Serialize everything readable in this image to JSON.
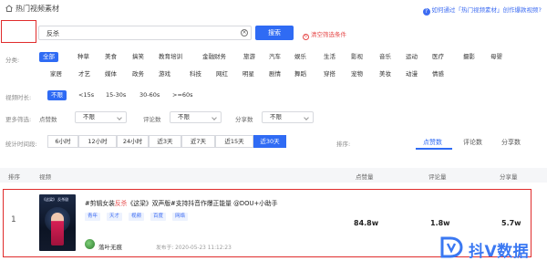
{
  "header": {
    "title": "热门视频素材",
    "help_text": "如何通过「热门视频素材」创作爆款视频?"
  },
  "search": {
    "value": "反杀",
    "button_label": "搜索",
    "clear_filters_label": "清空筛选条件"
  },
  "filters": {
    "category": {
      "label": "分类:",
      "row1": [
        "全部",
        "种草",
        "美食",
        "搞笑",
        "教育培训",
        "金融财务",
        "旅游",
        "汽车",
        "娱乐",
        "生活",
        "影视",
        "音乐",
        "运动",
        "医疗",
        "摄影",
        "母婴"
      ],
      "row2": [
        "家居",
        "才艺",
        "媒体",
        "政务",
        "游戏",
        "科技",
        "网红",
        "明星",
        "剧情",
        "舞蹈",
        "穿搭",
        "宠物",
        "美妆",
        "动漫",
        "情感"
      ],
      "selected": "全部"
    },
    "duration": {
      "label": "视频时长:",
      "options": [
        "不限",
        "<15s",
        "15-30s",
        "30-60s",
        ">=60s"
      ],
      "selected": "不限"
    },
    "more": {
      "label": "更多筛选:",
      "likes_label": "点赞数",
      "likes_value": "不限",
      "comments_label": "评论数",
      "comments_value": "不限",
      "shares_label": "分享数",
      "shares_value": "不限"
    },
    "time_range": {
      "label": "统计时间段:",
      "options": [
        "6小时",
        "12小时",
        "24小时",
        "近3天",
        "近7天",
        "近15天",
        "近30天"
      ],
      "selected": "近30天"
    },
    "sort": {
      "label": "排序:",
      "options": [
        "点赞数",
        "评论数",
        "分享数"
      ],
      "selected": "点赞数"
    }
  },
  "table": {
    "headers": {
      "rank": "排序",
      "video": "视频",
      "likes": "点赞量",
      "comments": "评论量",
      "shares": "分享量"
    },
    "rows": [
      {
        "rank": "1",
        "thumb_text": "《这梁》 反杀剧",
        "title_before": "#剪辑女装",
        "title_highlight": "反杀",
        "title_after": "《这梁》双声版#支持抖音作爆正能量 @DOU+小助手",
        "tags": [
          "青年",
          "天才",
          "视频",
          "百度",
          "网络"
        ],
        "author": "落叶无痕",
        "publish_time": "发布于: 2020-05-23 11:12:23",
        "likes": "84.8w",
        "comments": "1.8w",
        "shares": "5.7w"
      }
    ]
  },
  "watermark": {
    "text": "抖V数据"
  },
  "colors": {
    "accent": "#2f6bf4",
    "highlight_box": "#e02c2c",
    "keyword": "#e64b4b"
  }
}
